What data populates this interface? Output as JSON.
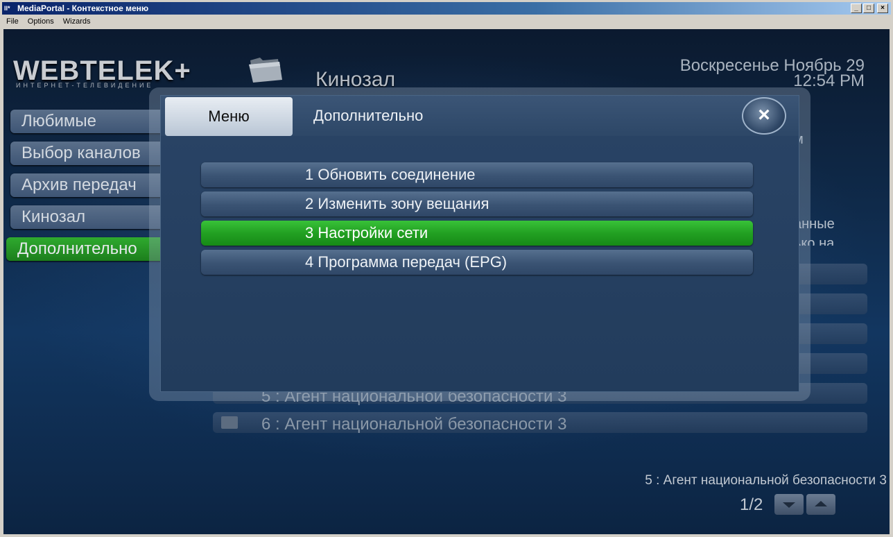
{
  "window": {
    "title": "MediaPortal - Контекстное меню",
    "app_icon": "II*",
    "buttons": [
      "_",
      "□",
      "×"
    ]
  },
  "menubar": [
    "File",
    "Options",
    "Wizards"
  ],
  "header": {
    "logo": "WEBTELEK+",
    "logo_subtitle": "ИНТЕРНЕТ-ТЕЛЕВИДЕНИЕ",
    "screen_title": "Кинозал",
    "date_line": "Воскресенье Ноябрь 29",
    "time_line": "12:54 PM"
  },
  "sidebar": {
    "items": [
      {
        "label": "Любимые"
      },
      {
        "label": "Выбор каналов"
      },
      {
        "label": "Архив передач"
      },
      {
        "label": "Кинозал"
      },
      {
        "label": "Дополнительно",
        "active": true
      }
    ]
  },
  "background_partial": {
    "right_fragment_1": "м",
    "right_fragment_2": "анные",
    "right_fragment_3": "ько на"
  },
  "list": {
    "items": [
      {
        "label": "5 : Агент национальной безопасности 3"
      },
      {
        "label": "6 : Агент национальной безопасности 3"
      }
    ]
  },
  "status": {
    "selected_item": "5 : Агент национальной безопасности 3",
    "page": "1/2"
  },
  "dialog": {
    "tab_label": "Меню",
    "title": "Дополнительно",
    "close_symbol": "×",
    "items": [
      {
        "label": "1 Обновить соединение"
      },
      {
        "label": "2 Изменить зону вещания"
      },
      {
        "label": "3 Настройки сети",
        "selected": true
      },
      {
        "label": "4 Программа передач (EPG)"
      }
    ]
  },
  "colors": {
    "selected_green": "#22a022",
    "background_navy": "#0f2a4a"
  }
}
